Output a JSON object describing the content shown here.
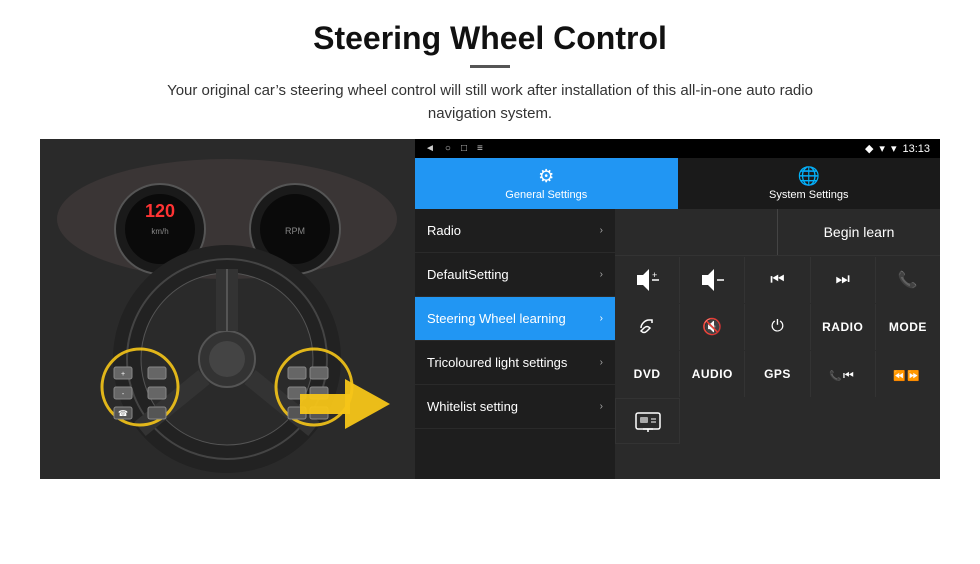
{
  "header": {
    "title": "Steering Wheel Control",
    "divider": true,
    "subtitle": "Your original car’s steering wheel control will still work after installation of this all-in-one auto radio navigation system."
  },
  "device": {
    "status_bar": {
      "back_icon": "◄",
      "circle_icon": "○",
      "square_icon": "□",
      "grid_icon": "☰",
      "signal_icon": "▾",
      "wifi_icon": "▾",
      "location_icon": "♦",
      "time": "13:13"
    },
    "tabs": [
      {
        "id": "general",
        "icon": "⚙",
        "label": "General Settings",
        "active": true
      },
      {
        "id": "system",
        "icon": "❤",
        "label": "System Settings",
        "active": false
      }
    ],
    "menu": [
      {
        "id": "radio",
        "label": "Radio",
        "active": false
      },
      {
        "id": "default",
        "label": "DefaultSetting",
        "active": false
      },
      {
        "id": "steering",
        "label": "Steering Wheel learning",
        "active": true
      },
      {
        "id": "tricoloured",
        "label": "Tricoloured light settings",
        "active": false
      },
      {
        "id": "whitelist",
        "label": "Whitelist setting",
        "active": false
      }
    ],
    "controls": {
      "begin_learn_label": "Begin learn",
      "row1": [
        {
          "icon": "🔊+",
          "type": "icon",
          "label": "vol-up"
        },
        {
          "icon": "🔊−",
          "type": "icon",
          "label": "vol-down"
        },
        {
          "icon": "⏮",
          "type": "icon",
          "label": "prev-track"
        },
        {
          "icon": "⏭",
          "type": "icon",
          "label": "next-track"
        },
        {
          "icon": "☎",
          "type": "icon",
          "label": "phone"
        }
      ],
      "row2": [
        {
          "icon": "↘",
          "type": "icon",
          "label": "answer"
        },
        {
          "icon": "🔇",
          "type": "icon",
          "label": "mute"
        },
        {
          "icon": "⏻",
          "type": "icon",
          "label": "power"
        },
        {
          "text": "RADIO",
          "type": "text",
          "label": "radio-btn"
        },
        {
          "text": "MODE",
          "type": "text",
          "label": "mode-btn"
        }
      ],
      "row3": [
        {
          "text": "DVD",
          "type": "text",
          "label": "dvd-btn"
        },
        {
          "text": "AUDIO",
          "type": "text",
          "label": "audio-btn"
        },
        {
          "text": "GPS",
          "type": "text",
          "label": "gps-btn"
        },
        {
          "icon": "☎⏮",
          "type": "icon",
          "label": "phone-prev"
        },
        {
          "icon": "⏪⏭",
          "type": "icon",
          "label": "skip-combo"
        }
      ],
      "row4_icon": "💻"
    }
  }
}
